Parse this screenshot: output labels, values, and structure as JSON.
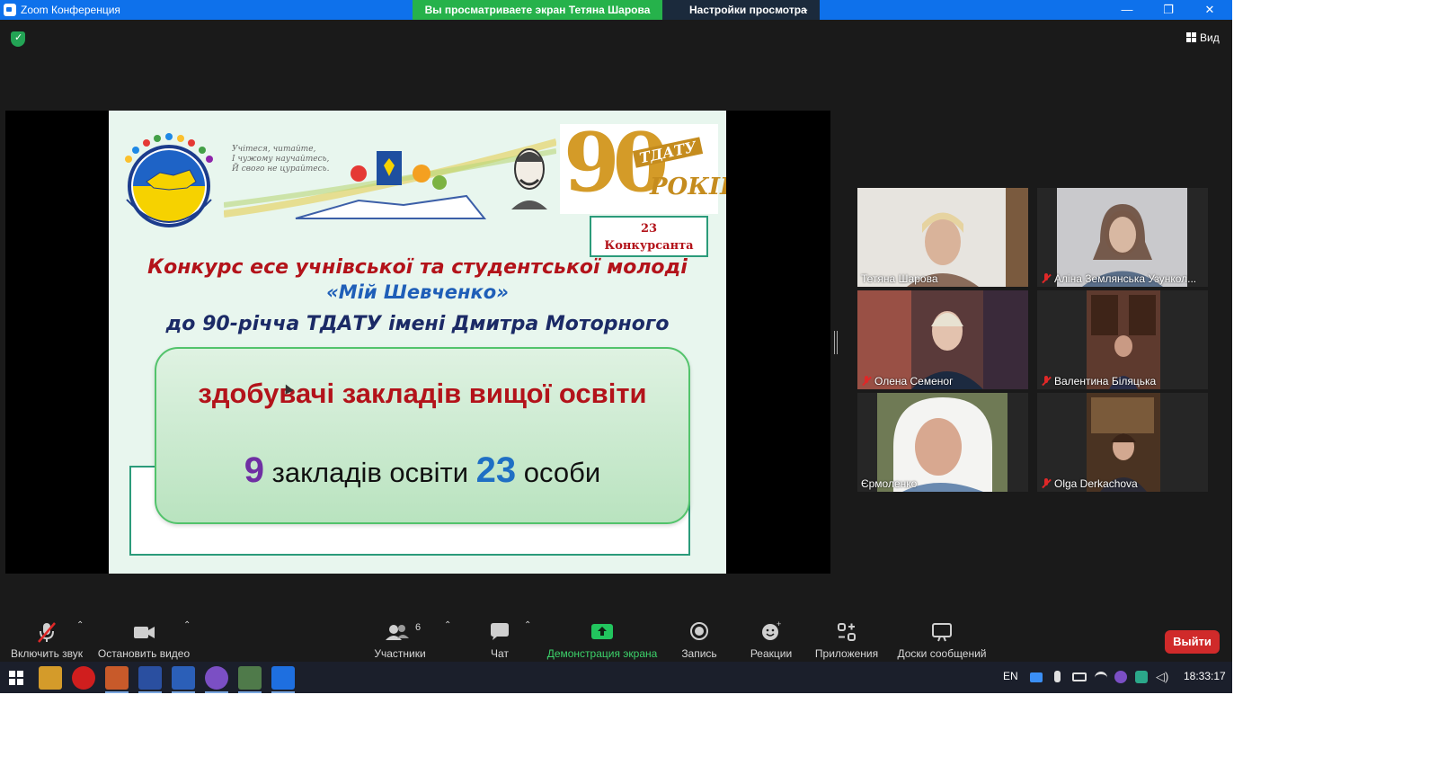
{
  "window": {
    "title": "Zoom Конференция",
    "share_banner": "Вы просматриваете экран Тетяна Шарова",
    "view_settings": "Настройки просмотра",
    "minimize": "—",
    "restore": "❐",
    "close": "✕",
    "view_label": "Вид"
  },
  "slide": {
    "handwriting": [
      "Учітеся, читайте,",
      "І чужому научайтесь,",
      "Й свого не цурайтесь."
    ],
    "anniversary_number": "90",
    "anniversary_brand": "ТДАТУ",
    "anniversary_years": "РОКІВ",
    "contestants_count": "23",
    "contestants_label": "Конкурсанта",
    "headline_1": "Конкурс есе учнівської та студентської молоді",
    "headline_2": "«Мій Шевченко»",
    "headline_3": "до 90-річча ТДАТУ імені Дмитра Моторного",
    "box_title": "здобувачі закладів вищої освіти",
    "stat_institutions_number": "9",
    "stat_institutions_label": "закладів освіти",
    "stat_persons_number": "23",
    "stat_persons_label": "особи"
  },
  "participants": [
    {
      "name": "Тетяна Шарова",
      "muted": false,
      "active": true
    },
    {
      "name": "Аліна Землянська Узункол...",
      "muted": true,
      "active": false
    },
    {
      "name": "Олена Семеног",
      "muted": true,
      "active": false
    },
    {
      "name": "Валентина Біляцька",
      "muted": true,
      "active": false
    },
    {
      "name": "Єрмоленко",
      "muted": false,
      "active": false
    },
    {
      "name": "Olga Derkachova",
      "muted": true,
      "active": false
    }
  ],
  "toolbar": {
    "unmute": "Включить звук",
    "stop_video": "Остановить видео",
    "participants": "Участники",
    "participants_count": "6",
    "chat": "Чат",
    "share_screen": "Демонстрация экрана",
    "record": "Запись",
    "reactions": "Реакции",
    "apps": "Приложения",
    "whiteboards": "Доски сообщений",
    "leave": "Выйти"
  },
  "taskbar": {
    "language": "EN",
    "time": "18:33:17"
  },
  "colors": {
    "title_bar": "#0e71eb",
    "share_banner": "#26b24b",
    "leave": "#d02a2a",
    "active_speaker": "#d7e24a",
    "share_icon": "#22c55e"
  }
}
